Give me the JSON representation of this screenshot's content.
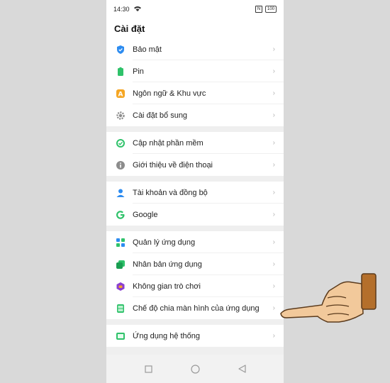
{
  "status": {
    "time": "14:30",
    "battery": "100"
  },
  "title": "Cài đặt",
  "groups": [
    [
      {
        "label": "Bảo mật",
        "icon": "shield-icon"
      },
      {
        "label": "Pin",
        "icon": "battery-icon"
      },
      {
        "label": "Ngôn ngữ & Khu vực",
        "icon": "language-icon"
      },
      {
        "label": "Cài đặt bổ sung",
        "icon": "gear-icon"
      }
    ],
    [
      {
        "label": "Cập nhật phần mềm",
        "icon": "update-icon"
      },
      {
        "label": "Giới thiệu về điện thoại",
        "icon": "info-icon"
      }
    ],
    [
      {
        "label": "Tài khoản và đồng bộ",
        "icon": "account-icon"
      },
      {
        "label": "Google",
        "icon": "google-icon"
      }
    ],
    [
      {
        "label": "Quản lý ứng dụng",
        "icon": "app-grid-icon"
      },
      {
        "label": "Nhân bản ứng dụng",
        "icon": "clone-app-icon"
      },
      {
        "label": "Không gian trò chơi",
        "icon": "game-space-icon"
      },
      {
        "label": "Chế độ chia màn hình của ứng dụng",
        "icon": "split-screen-icon"
      }
    ],
    [
      {
        "label": "Ứng dụng hệ thống",
        "icon": "system-apps-icon"
      }
    ]
  ],
  "colors": {
    "accent_blue": "#2d8cf0",
    "green": "#2fc26a",
    "orange": "#f5a623",
    "purple": "#8a3fd1"
  }
}
